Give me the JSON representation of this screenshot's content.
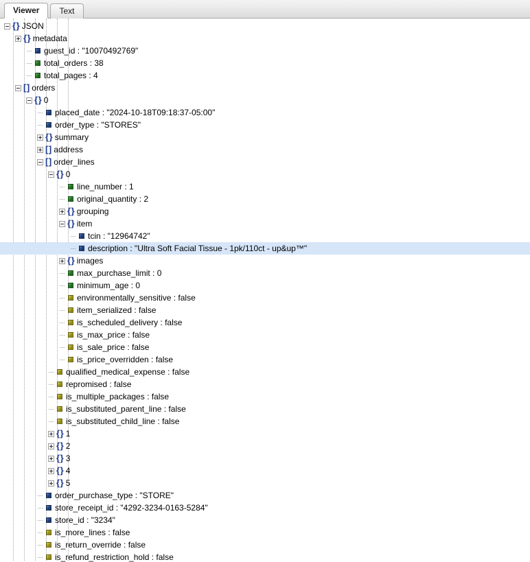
{
  "tabs": [
    {
      "label": "Viewer",
      "active": true
    },
    {
      "label": "Text",
      "active": false
    }
  ],
  "colors": {
    "selection": "#d6e5f8",
    "node_glyph": "#1f3a93",
    "string_square": "#1b3a73",
    "number_square": "#1d6b1d",
    "boolean_square": "#8f8a14"
  },
  "tree": {
    "rows": [
      {
        "depth": 0,
        "expander": "minus",
        "kind": "object",
        "text": "JSON"
      },
      {
        "depth": 1,
        "expander": "plus",
        "kind": "object",
        "text": "metadata"
      },
      {
        "depth": 2,
        "expander": "none",
        "kind": "string",
        "text": "guest_id : \"10070492769\""
      },
      {
        "depth": 2,
        "expander": "none",
        "kind": "number",
        "text": "total_orders : 38"
      },
      {
        "depth": 2,
        "expander": "none",
        "kind": "number",
        "text": "total_pages : 4"
      },
      {
        "depth": 1,
        "expander": "minus",
        "kind": "array",
        "text": "orders"
      },
      {
        "depth": 2,
        "expander": "minus",
        "kind": "object",
        "text": "0"
      },
      {
        "depth": 3,
        "expander": "none",
        "kind": "string",
        "text": "placed_date : \"2024-10-18T09:18:37-05:00\""
      },
      {
        "depth": 3,
        "expander": "none",
        "kind": "string",
        "text": "order_type : \"STORES\""
      },
      {
        "depth": 3,
        "expander": "plus",
        "kind": "object",
        "text": "summary"
      },
      {
        "depth": 3,
        "expander": "plus",
        "kind": "array",
        "text": "address"
      },
      {
        "depth": 3,
        "expander": "minus",
        "kind": "array",
        "text": "order_lines"
      },
      {
        "depth": 4,
        "expander": "minus",
        "kind": "object",
        "text": "0"
      },
      {
        "depth": 5,
        "expander": "none",
        "kind": "number",
        "text": "line_number : 1"
      },
      {
        "depth": 5,
        "expander": "none",
        "kind": "number",
        "text": "original_quantity : 2"
      },
      {
        "depth": 5,
        "expander": "plus",
        "kind": "object",
        "text": "grouping"
      },
      {
        "depth": 5,
        "expander": "minus",
        "kind": "object",
        "text": "item"
      },
      {
        "depth": 6,
        "expander": "none",
        "kind": "string",
        "text": "tcin : \"12964742\""
      },
      {
        "depth": 6,
        "expander": "none",
        "kind": "string",
        "text": "description : \"Ultra Soft Facial Tissue - 1pk/110ct - up&up™\"",
        "selected": true
      },
      {
        "depth": 5,
        "expander": "plus",
        "kind": "object",
        "text": "images"
      },
      {
        "depth": 5,
        "expander": "none",
        "kind": "number",
        "text": "max_purchase_limit : 0"
      },
      {
        "depth": 5,
        "expander": "none",
        "kind": "number",
        "text": "minimum_age : 0"
      },
      {
        "depth": 5,
        "expander": "none",
        "kind": "boolean",
        "text": "environmentally_sensitive : false"
      },
      {
        "depth": 5,
        "expander": "none",
        "kind": "boolean",
        "text": "item_serialized : false"
      },
      {
        "depth": 5,
        "expander": "none",
        "kind": "boolean",
        "text": "is_scheduled_delivery : false"
      },
      {
        "depth": 5,
        "expander": "none",
        "kind": "boolean",
        "text": "is_max_price : false"
      },
      {
        "depth": 5,
        "expander": "none",
        "kind": "boolean",
        "text": "is_sale_price : false"
      },
      {
        "depth": 5,
        "expander": "none",
        "kind": "boolean",
        "text": "is_price_overridden : false"
      },
      {
        "depth": 4,
        "expander": "none",
        "kind": "boolean",
        "text": "qualified_medical_expense : false"
      },
      {
        "depth": 4,
        "expander": "none",
        "kind": "boolean",
        "text": "repromised : false"
      },
      {
        "depth": 4,
        "expander": "none",
        "kind": "boolean",
        "text": "is_multiple_packages : false"
      },
      {
        "depth": 4,
        "expander": "none",
        "kind": "boolean",
        "text": "is_substituted_parent_line : false"
      },
      {
        "depth": 4,
        "expander": "none",
        "kind": "boolean",
        "text": "is_substituted_child_line : false"
      },
      {
        "depth": 4,
        "expander": "plus",
        "kind": "object",
        "text": "1"
      },
      {
        "depth": 4,
        "expander": "plus",
        "kind": "object",
        "text": "2"
      },
      {
        "depth": 4,
        "expander": "plus",
        "kind": "object",
        "text": "3"
      },
      {
        "depth": 4,
        "expander": "plus",
        "kind": "object",
        "text": "4"
      },
      {
        "depth": 4,
        "expander": "plus",
        "kind": "object",
        "text": "5"
      },
      {
        "depth": 3,
        "expander": "none",
        "kind": "string",
        "text": "order_purchase_type : \"STORE\""
      },
      {
        "depth": 3,
        "expander": "none",
        "kind": "string",
        "text": "store_receipt_id : \"4292-3234-0163-5284\""
      },
      {
        "depth": 3,
        "expander": "none",
        "kind": "string",
        "text": "store_id : \"3234\""
      },
      {
        "depth": 3,
        "expander": "none",
        "kind": "boolean",
        "text": "is_more_lines : false"
      },
      {
        "depth": 3,
        "expander": "none",
        "kind": "boolean",
        "text": "is_return_override : false"
      },
      {
        "depth": 3,
        "expander": "none",
        "kind": "boolean",
        "text": "is_refund_restriction_hold : false"
      }
    ],
    "guides": [
      {
        "depth": 1
      },
      {
        "depth": 2
      },
      {
        "depth": 3
      },
      {
        "depth": 4
      },
      {
        "depth": 5
      },
      {
        "depth": 6
      }
    ]
  }
}
